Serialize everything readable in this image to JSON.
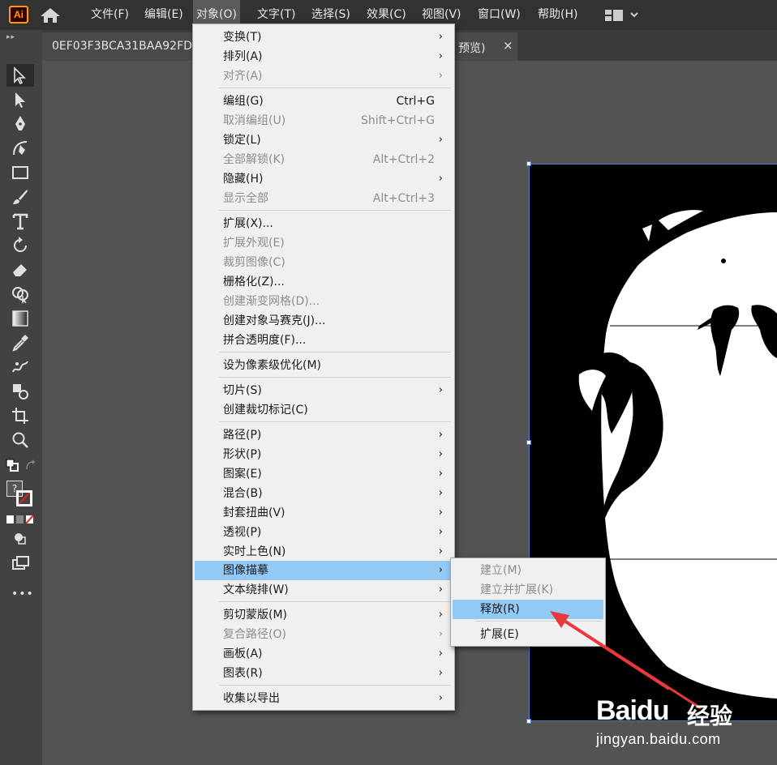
{
  "app": {
    "logo_text": "Ai",
    "accent": "#ff9a00",
    "highlight_color": "#93c9f5",
    "annotation_color": "#e8383b"
  },
  "menubar": {
    "items": [
      {
        "label": "文件(F)"
      },
      {
        "label": "编辑(E)"
      },
      {
        "label": "对象(O)"
      },
      {
        "label": "文字(T)"
      },
      {
        "label": "选择(S)"
      },
      {
        "label": "效果(C)"
      },
      {
        "label": "视图(V)"
      },
      {
        "label": "窗口(W)"
      },
      {
        "label": "帮助(H)"
      }
    ],
    "active_menu": "对象(O)"
  },
  "document_tab": {
    "name": "0EF03F3BCA31BAA92FD",
    "suffix": "预览)",
    "close": "×"
  },
  "toolbar": {
    "tools": [
      "selection-tool",
      "direct-selection-tool",
      "pen-tool",
      "curvature-tool",
      "rectangle-tool",
      "paintbrush-tool",
      "type-tool",
      "rotate-tool",
      "eraser-tool",
      "shape-builder-tool",
      "gradient-tool",
      "eyedropper-tool",
      "puppet-warp-tool",
      "symbol-sprayer-tool",
      "artboard-tool",
      "zoom-tool"
    ],
    "more": "•••",
    "fill_stroke_unknown": "?"
  },
  "object_menu": {
    "items": [
      {
        "label": "变换(T)",
        "shortcut": "",
        "submenu": true,
        "disabled": false
      },
      {
        "label": "排列(A)",
        "shortcut": "",
        "submenu": true,
        "disabled": false
      },
      {
        "label": "对齐(A)",
        "shortcut": "",
        "submenu": true,
        "disabled": true
      },
      {
        "label": "编组(G)",
        "shortcut": "Ctrl+G",
        "submenu": false,
        "disabled": false
      },
      {
        "label": "取消编组(U)",
        "shortcut": "Shift+Ctrl+G",
        "submenu": false,
        "disabled": true
      },
      {
        "label": "锁定(L)",
        "shortcut": "",
        "submenu": true,
        "disabled": false
      },
      {
        "label": "全部解锁(K)",
        "shortcut": "Alt+Ctrl+2",
        "submenu": false,
        "disabled": true
      },
      {
        "label": "隐藏(H)",
        "shortcut": "",
        "submenu": true,
        "disabled": false
      },
      {
        "label": "显示全部",
        "shortcut": "Alt+Ctrl+3",
        "submenu": false,
        "disabled": true
      },
      {
        "label": "扩展(X)...",
        "shortcut": "",
        "submenu": false,
        "disabled": false
      },
      {
        "label": "扩展外观(E)",
        "shortcut": "",
        "submenu": false,
        "disabled": true
      },
      {
        "label": "裁剪图像(C)",
        "shortcut": "",
        "submenu": false,
        "disabled": true
      },
      {
        "label": "栅格化(Z)...",
        "shortcut": "",
        "submenu": false,
        "disabled": false
      },
      {
        "label": "创建渐变网格(D)...",
        "shortcut": "",
        "submenu": false,
        "disabled": true
      },
      {
        "label": "创建对象马赛克(J)...",
        "shortcut": "",
        "submenu": false,
        "disabled": false
      },
      {
        "label": "拼合透明度(F)...",
        "shortcut": "",
        "submenu": false,
        "disabled": false
      },
      {
        "label": "设为像素级优化(M)",
        "shortcut": "",
        "submenu": false,
        "disabled": false
      },
      {
        "label": "切片(S)",
        "shortcut": "",
        "submenu": true,
        "disabled": false
      },
      {
        "label": "创建裁切标记(C)",
        "shortcut": "",
        "submenu": false,
        "disabled": false
      },
      {
        "label": "路径(P)",
        "shortcut": "",
        "submenu": true,
        "disabled": false
      },
      {
        "label": "形状(P)",
        "shortcut": "",
        "submenu": true,
        "disabled": false
      },
      {
        "label": "图案(E)",
        "shortcut": "",
        "submenu": true,
        "disabled": false
      },
      {
        "label": "混合(B)",
        "shortcut": "",
        "submenu": true,
        "disabled": false
      },
      {
        "label": "封套扭曲(V)",
        "shortcut": "",
        "submenu": true,
        "disabled": false
      },
      {
        "label": "透视(P)",
        "shortcut": "",
        "submenu": true,
        "disabled": false
      },
      {
        "label": "实时上色(N)",
        "shortcut": "",
        "submenu": true,
        "disabled": false
      },
      {
        "label": "图像描摹",
        "shortcut": "",
        "submenu": true,
        "disabled": false,
        "highlighted": true
      },
      {
        "label": "文本绕排(W)",
        "shortcut": "",
        "submenu": true,
        "disabled": false
      },
      {
        "label": "剪切蒙版(M)",
        "shortcut": "",
        "submenu": true,
        "disabled": false
      },
      {
        "label": "复合路径(O)",
        "shortcut": "",
        "submenu": true,
        "disabled": true
      },
      {
        "label": "画板(A)",
        "shortcut": "",
        "submenu": true,
        "disabled": false
      },
      {
        "label": "图表(R)",
        "shortcut": "",
        "submenu": true,
        "disabled": false
      },
      {
        "label": "收集以导出",
        "shortcut": "",
        "submenu": true,
        "disabled": false
      }
    ]
  },
  "trace_submenu": {
    "items": [
      {
        "label": "建立(M)",
        "disabled": true
      },
      {
        "label": "建立并扩展(K)",
        "disabled": true
      },
      {
        "label": "释放(R)",
        "disabled": false,
        "highlighted": true
      },
      {
        "label": "扩展(E)",
        "disabled": false
      }
    ]
  },
  "watermark": {
    "brand": "Bai",
    "brand2": "du",
    "cn": "经验",
    "url": "jingyan.baidu.com"
  }
}
